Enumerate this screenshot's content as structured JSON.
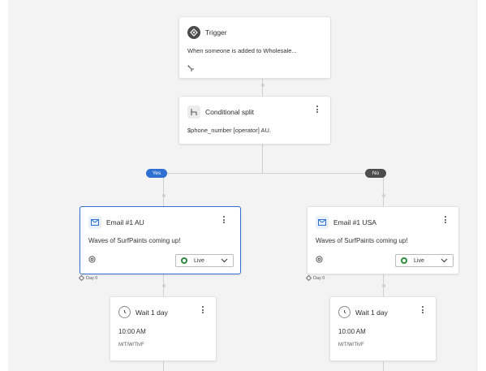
{
  "trigger": {
    "title": "Trigger",
    "description": "When someone is added to Wholesale...",
    "icon": "trigger-icon"
  },
  "split": {
    "title": "Conditional split",
    "condition": "$phone_number [operator] AU.",
    "icon": "split-icon"
  },
  "branches": {
    "yes_label": "Yes",
    "no_label": "No",
    "yes_color": "#2f6fd1",
    "no_color": "#4d4d4d"
  },
  "email_au": {
    "title": "Email #1 AU",
    "subject": "Waves of SurfPaints coming up!",
    "status": "Live",
    "day_label": "Day 0"
  },
  "email_usa": {
    "title": "Email #1 USA",
    "subject": "Waves of SurfPaints coming up!",
    "status": "Live",
    "day_label": "Day 0"
  },
  "wait_left": {
    "title": "Wait 1 day",
    "time": "10:00 AM",
    "days": "M/T/W/Th/F"
  },
  "wait_right": {
    "title": "Wait 1 day",
    "time": "10:00 AM",
    "days": "M/T/W/Th/F"
  },
  "colors": {
    "canvas": "#f3f3f3",
    "selected_border": "#2f6fd1",
    "live_green": "#2e8b3d"
  }
}
